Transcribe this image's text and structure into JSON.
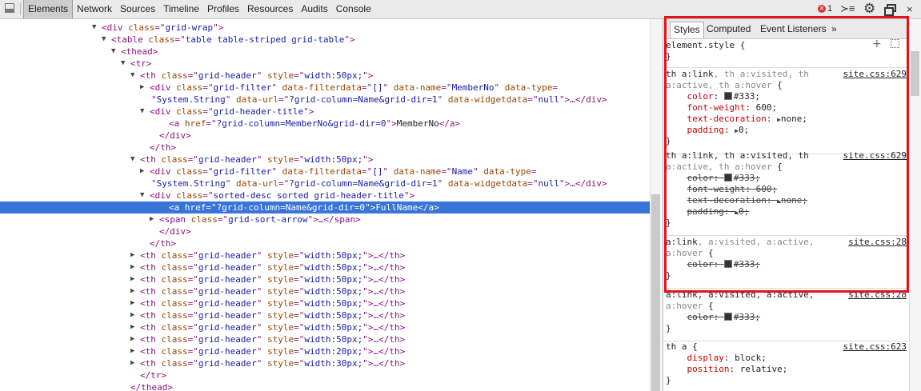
{
  "toolbar": {
    "tabs": [
      "Elements",
      "Network",
      "Sources",
      "Timeline",
      "Profiles",
      "Resources",
      "Audits",
      "Console"
    ],
    "error_count": "1",
    "close": "×"
  },
  "dom": {
    "lines": [
      {
        "indent": 127,
        "arrow": "▼",
        "html": [
          [
            "t",
            "<div "
          ],
          [
            "an",
            "class"
          ],
          [
            "t",
            "=\""
          ],
          [
            "av",
            "grid-wrap"
          ],
          [
            "t",
            "\">"
          ]
        ]
      },
      {
        "indent": 139,
        "arrow": "▼",
        "html": [
          [
            "t",
            "<table "
          ],
          [
            "an",
            "class"
          ],
          [
            "t",
            "=\""
          ],
          [
            "av",
            "table table-striped grid-table"
          ],
          [
            "t",
            "\">"
          ]
        ]
      },
      {
        "indent": 151,
        "arrow": "▼",
        "html": [
          [
            "t",
            "<thead>"
          ]
        ]
      },
      {
        "indent": 163,
        "arrow": "▼",
        "html": [
          [
            "t",
            "<tr>"
          ]
        ]
      },
      {
        "indent": 175,
        "arrow": "▼",
        "html": [
          [
            "t",
            "<th "
          ],
          [
            "an",
            "class"
          ],
          [
            "t",
            "=\""
          ],
          [
            "av",
            "grid-header"
          ],
          [
            "t",
            "\" "
          ],
          [
            "an",
            "style"
          ],
          [
            "t",
            "=\""
          ],
          [
            "av",
            "width:50px;"
          ],
          [
            "t",
            "\">"
          ]
        ]
      },
      {
        "indent": 187,
        "arrow": "▶",
        "html": [
          [
            "t",
            "<div "
          ],
          [
            "an",
            "class"
          ],
          [
            "t",
            "=\""
          ],
          [
            "av",
            "grid-filter"
          ],
          [
            "t",
            "\" "
          ],
          [
            "an",
            "data-filterdata"
          ],
          [
            "t",
            "=\""
          ],
          [
            "av",
            "[]"
          ],
          [
            "t",
            "\" "
          ],
          [
            "an",
            "data-name"
          ],
          [
            "t",
            "=\""
          ],
          [
            "av",
            "MemberNo"
          ],
          [
            "t",
            "\" "
          ],
          [
            "an",
            "data-type"
          ],
          [
            "t",
            "="
          ]
        ]
      },
      {
        "indent": 189,
        "arrow": "",
        "html": [
          [
            "t",
            "\""
          ],
          [
            "av",
            "System.String"
          ],
          [
            "t",
            "\" "
          ],
          [
            "an",
            "data-url"
          ],
          [
            "t",
            "=\""
          ],
          [
            "av",
            "?grid-column=Name&grid-dir=1"
          ],
          [
            "t",
            "\" "
          ],
          [
            "an",
            "data-widgetdata"
          ],
          [
            "t",
            "=\""
          ],
          [
            "av",
            "null"
          ],
          [
            "t",
            "\">…</div>"
          ]
        ]
      },
      {
        "indent": 187,
        "arrow": "▼",
        "html": [
          [
            "t",
            "<div "
          ],
          [
            "an",
            "class"
          ],
          [
            "t",
            "=\""
          ],
          [
            "av",
            "grid-header-title"
          ],
          [
            "t",
            "\">"
          ]
        ]
      },
      {
        "indent": 211,
        "arrow": "",
        "html": [
          [
            "t",
            "<a "
          ],
          [
            "an",
            "href"
          ],
          [
            "t",
            "=\""
          ],
          [
            "av",
            "?grid-column=MemberNo&grid-dir=0"
          ],
          [
            "t",
            "\">"
          ],
          [
            "x",
            "MemberNo"
          ],
          [
            "t",
            "</a>"
          ]
        ]
      },
      {
        "indent": 199,
        "arrow": "",
        "html": [
          [
            "t",
            "</div>"
          ]
        ]
      },
      {
        "indent": 187,
        "arrow": "",
        "html": [
          [
            "t",
            "</th>"
          ]
        ]
      },
      {
        "indent": 175,
        "arrow": "▼",
        "html": [
          [
            "t",
            "<th "
          ],
          [
            "an",
            "class"
          ],
          [
            "t",
            "=\""
          ],
          [
            "av",
            "grid-header"
          ],
          [
            "t",
            "\" "
          ],
          [
            "an",
            "style"
          ],
          [
            "t",
            "=\""
          ],
          [
            "av",
            "width:50px;"
          ],
          [
            "t",
            "\">"
          ]
        ]
      },
      {
        "indent": 187,
        "arrow": "▶",
        "html": [
          [
            "t",
            "<div "
          ],
          [
            "an",
            "class"
          ],
          [
            "t",
            "=\""
          ],
          [
            "av",
            "grid-filter"
          ],
          [
            "t",
            "\" "
          ],
          [
            "an",
            "data-filterdata"
          ],
          [
            "t",
            "=\""
          ],
          [
            "av",
            "[]"
          ],
          [
            "t",
            "\" "
          ],
          [
            "an",
            "data-name"
          ],
          [
            "t",
            "=\""
          ],
          [
            "av",
            "Name"
          ],
          [
            "t",
            "\" "
          ],
          [
            "an",
            "data-type"
          ],
          [
            "t",
            "="
          ]
        ]
      },
      {
        "indent": 189,
        "arrow": "",
        "html": [
          [
            "t",
            "\""
          ],
          [
            "av",
            "System.String"
          ],
          [
            "t",
            "\" "
          ],
          [
            "an",
            "data-url"
          ],
          [
            "t",
            "=\""
          ],
          [
            "av",
            "?grid-column=Name&grid-dir=1"
          ],
          [
            "t",
            "\" "
          ],
          [
            "an",
            "data-widgetdata"
          ],
          [
            "t",
            "=\""
          ],
          [
            "av",
            "null"
          ],
          [
            "t",
            "\">…</div>"
          ]
        ]
      },
      {
        "indent": 187,
        "arrow": "▼",
        "html": [
          [
            "t",
            "<div "
          ],
          [
            "an",
            "class"
          ],
          [
            "t",
            "=\""
          ],
          [
            "av",
            "sorted-desc sorted grid-header-title"
          ],
          [
            "t",
            "\">"
          ]
        ]
      },
      {
        "indent": 211,
        "arrow": "",
        "sel": true,
        "html": [
          [
            "t",
            "<a "
          ],
          [
            "an",
            "href"
          ],
          [
            "t",
            "=\""
          ],
          [
            "av",
            "?grid-column=Name&grid-dir=0"
          ],
          [
            "t",
            "\">"
          ],
          [
            "x",
            "FullName"
          ],
          [
            "t",
            "</a>"
          ]
        ]
      },
      {
        "indent": 199,
        "arrow": "▶",
        "html": [
          [
            "t",
            "<span "
          ],
          [
            "an",
            "class"
          ],
          [
            "t",
            "=\""
          ],
          [
            "av",
            "grid-sort-arrow"
          ],
          [
            "t",
            "\">…</span>"
          ]
        ]
      },
      {
        "indent": 199,
        "arrow": "",
        "html": [
          [
            "t",
            "</div>"
          ]
        ]
      },
      {
        "indent": 187,
        "arrow": "",
        "html": [
          [
            "t",
            "</th>"
          ]
        ]
      },
      {
        "indent": 175,
        "arrow": "▶",
        "html": [
          [
            "t",
            "<th "
          ],
          [
            "an",
            "class"
          ],
          [
            "t",
            "=\""
          ],
          [
            "av",
            "grid-header"
          ],
          [
            "t",
            "\" "
          ],
          [
            "an",
            "style"
          ],
          [
            "t",
            "=\""
          ],
          [
            "av",
            "width:50px;"
          ],
          [
            "t",
            "\">…</th>"
          ]
        ]
      },
      {
        "indent": 175,
        "arrow": "▶",
        "html": [
          [
            "t",
            "<th "
          ],
          [
            "an",
            "class"
          ],
          [
            "t",
            "=\""
          ],
          [
            "av",
            "grid-header"
          ],
          [
            "t",
            "\" "
          ],
          [
            "an",
            "style"
          ],
          [
            "t",
            "=\""
          ],
          [
            "av",
            "width:50px;"
          ],
          [
            "t",
            "\">…</th>"
          ]
        ]
      },
      {
        "indent": 175,
        "arrow": "▶",
        "html": [
          [
            "t",
            "<th "
          ],
          [
            "an",
            "class"
          ],
          [
            "t",
            "=\""
          ],
          [
            "av",
            "grid-header"
          ],
          [
            "t",
            "\" "
          ],
          [
            "an",
            "style"
          ],
          [
            "t",
            "=\""
          ],
          [
            "av",
            "width:50px;"
          ],
          [
            "t",
            "\">…</th>"
          ]
        ]
      },
      {
        "indent": 175,
        "arrow": "▶",
        "html": [
          [
            "t",
            "<th "
          ],
          [
            "an",
            "class"
          ],
          [
            "t",
            "=\""
          ],
          [
            "av",
            "grid-header"
          ],
          [
            "t",
            "\" "
          ],
          [
            "an",
            "style"
          ],
          [
            "t",
            "=\""
          ],
          [
            "av",
            "width:50px;"
          ],
          [
            "t",
            "\">…</th>"
          ]
        ]
      },
      {
        "indent": 175,
        "arrow": "▶",
        "html": [
          [
            "t",
            "<th "
          ],
          [
            "an",
            "class"
          ],
          [
            "t",
            "=\""
          ],
          [
            "av",
            "grid-header"
          ],
          [
            "t",
            "\" "
          ],
          [
            "an",
            "style"
          ],
          [
            "t",
            "=\""
          ],
          [
            "av",
            "width:50px;"
          ],
          [
            "t",
            "\">…</th>"
          ]
        ]
      },
      {
        "indent": 175,
        "arrow": "▶",
        "html": [
          [
            "t",
            "<th "
          ],
          [
            "an",
            "class"
          ],
          [
            "t",
            "=\""
          ],
          [
            "av",
            "grid-header"
          ],
          [
            "t",
            "\" "
          ],
          [
            "an",
            "style"
          ],
          [
            "t",
            "=\""
          ],
          [
            "av",
            "width:50px;"
          ],
          [
            "t",
            "\">…</th>"
          ]
        ]
      },
      {
        "indent": 175,
        "arrow": "▶",
        "html": [
          [
            "t",
            "<th "
          ],
          [
            "an",
            "class"
          ],
          [
            "t",
            "=\""
          ],
          [
            "av",
            "grid-header"
          ],
          [
            "t",
            "\" "
          ],
          [
            "an",
            "style"
          ],
          [
            "t",
            "=\""
          ],
          [
            "av",
            "width:50px;"
          ],
          [
            "t",
            "\">…</th>"
          ]
        ]
      },
      {
        "indent": 175,
        "arrow": "▶",
        "html": [
          [
            "t",
            "<th "
          ],
          [
            "an",
            "class"
          ],
          [
            "t",
            "=\""
          ],
          [
            "av",
            "grid-header"
          ],
          [
            "t",
            "\" "
          ],
          [
            "an",
            "style"
          ],
          [
            "t",
            "=\""
          ],
          [
            "av",
            "width:50px;"
          ],
          [
            "t",
            "\">…</th>"
          ]
        ]
      },
      {
        "indent": 175,
        "arrow": "▶",
        "html": [
          [
            "t",
            "<th "
          ],
          [
            "an",
            "class"
          ],
          [
            "t",
            "=\""
          ],
          [
            "av",
            "grid-header"
          ],
          [
            "t",
            "\" "
          ],
          [
            "an",
            "style"
          ],
          [
            "t",
            "=\""
          ],
          [
            "av",
            "width:20px;"
          ],
          [
            "t",
            "\">…</th>"
          ]
        ]
      },
      {
        "indent": 175,
        "arrow": "▶",
        "html": [
          [
            "t",
            "<th "
          ],
          [
            "an",
            "class"
          ],
          [
            "t",
            "=\""
          ],
          [
            "av",
            "grid-header"
          ],
          [
            "t",
            "\" "
          ],
          [
            "an",
            "style"
          ],
          [
            "t",
            "=\""
          ],
          [
            "av",
            "width:30px;"
          ],
          [
            "t",
            "\">…</th>"
          ]
        ]
      },
      {
        "indent": 175,
        "arrow": "",
        "html": [
          [
            "t",
            "</tr>"
          ]
        ]
      },
      {
        "indent": 163,
        "arrow": "",
        "html": [
          [
            "t",
            "</thead>"
          ]
        ]
      }
    ]
  },
  "sidebar": {
    "tabs": [
      "Styles",
      "Computed",
      "Event Listeners"
    ],
    "more": "»",
    "element_style": {
      "selector": "element.style {",
      "close": "}"
    },
    "rules": [
      {
        "selector_1": "th a:link",
        "selector_1_rest": ", th a:visited, th",
        "selector_2": "a:active, th a:hover",
        "open": " {",
        "source": "site.css:629",
        "props": [
          {
            "name": "color",
            "value": "#333;",
            "swatch": true
          },
          {
            "name": "font-weight",
            "value": "600;"
          },
          {
            "name": "text-decoration",
            "value": "none;",
            "tri": true
          },
          {
            "name": "padding",
            "value": "0;",
            "tri": true
          }
        ],
        "struck": false
      },
      {
        "selector_1": "th a:link, th a:visited, th",
        "selector_1_rest": "",
        "selector_2": "a:active, th a:hover",
        "open": " {",
        "source": "site.css:629",
        "props": [
          {
            "name": "color",
            "value": "#333;",
            "swatch": true
          },
          {
            "name": "font-weight",
            "value": "600;"
          },
          {
            "name": "text-decoration",
            "value": "none;",
            "tri": true
          },
          {
            "name": "padding",
            "value": "0;",
            "tri": true
          }
        ],
        "struck": true
      },
      {
        "selector_1": "a:link",
        "selector_1_rest": ", a:visited, a:active,",
        "selector_2": "a:hover",
        "open": " {",
        "source": "site.css:28",
        "props": [
          {
            "name": "color",
            "value": "#333;",
            "swatch": true
          }
        ],
        "struck": true
      },
      {
        "selector_1": "a:link, a:visited, a:active,",
        "selector_1_rest": "",
        "selector_2": "a:hover",
        "open": " {",
        "source": "site.css:28",
        "props": [
          {
            "name": "color",
            "value": "#333;",
            "swatch": true
          }
        ],
        "struck": true
      },
      {
        "selector_1": "th a",
        "selector_1_rest": "",
        "selector_2": "",
        "open": " {",
        "source": "site.css:623",
        "props": [
          {
            "name": "display",
            "value": "block;"
          },
          {
            "name": "position",
            "value": "relative;"
          }
        ],
        "struck": false
      }
    ],
    "close_brace": "}"
  },
  "colors": {
    "highlight": "#e3131d",
    "selection": "#3875d7",
    "tag": "#881280",
    "attr_name": "#994500",
    "attr_value": "#1a1aa6"
  }
}
